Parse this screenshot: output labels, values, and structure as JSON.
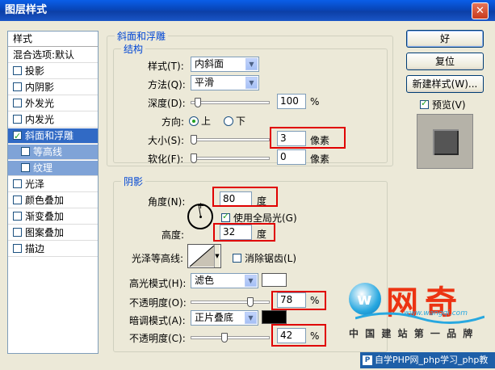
{
  "window": {
    "title": "图层样式",
    "close_glyph": "✕"
  },
  "left_list": {
    "header": "样式",
    "blend_default": "混合选项:默认",
    "items": [
      {
        "label": "投影",
        "checked": false
      },
      {
        "label": "内阴影",
        "checked": false
      },
      {
        "label": "外发光",
        "checked": false
      },
      {
        "label": "内发光",
        "checked": false
      },
      {
        "label": "斜面和浮雕",
        "checked": true,
        "selected": true
      },
      {
        "label": "等高线",
        "checked": false,
        "sub": true
      },
      {
        "label": "纹理",
        "checked": false,
        "sub": true
      },
      {
        "label": "光泽",
        "checked": false
      },
      {
        "label": "颜色叠加",
        "checked": false
      },
      {
        "label": "渐变叠加",
        "checked": false
      },
      {
        "label": "图案叠加",
        "checked": false
      },
      {
        "label": "描边",
        "checked": false
      }
    ]
  },
  "bevel": {
    "section_title": "斜面和浮雕",
    "structure_title": "结构",
    "style_label": "样式(T):",
    "style_value": "内斜面",
    "technique_label": "方法(Q):",
    "technique_value": "平滑",
    "depth_label": "深度(D):",
    "depth_value": "100",
    "depth_unit": "%",
    "direction_label": "方向:",
    "dir_up": "上",
    "dir_down": "下",
    "size_label": "大小(S):",
    "size_value": "3",
    "size_unit": "像素",
    "soften_label": "软化(F):",
    "soften_value": "0",
    "soften_unit": "像素"
  },
  "shading": {
    "title": "阴影",
    "angle_label": "角度(N):",
    "angle_value": "80",
    "angle_unit": "度",
    "global_light_label": "使用全局光(G)",
    "altitude_label": "高度:",
    "altitude_value": "32",
    "altitude_unit": "度",
    "gloss_label": "光泽等高线:",
    "antialias_label": "消除锯齿(L)",
    "highlight_mode_label": "高光模式(H):",
    "highlight_mode_value": "滤色",
    "highlight_opacity_label": "不透明度(O):",
    "highlight_opacity_value": "78",
    "highlight_opacity_unit": "%",
    "shadow_mode_label": "暗调模式(A):",
    "shadow_mode_value": "正片叠底",
    "shadow_opacity_label": "不透明度(C):",
    "shadow_opacity_value": "42",
    "shadow_opacity_unit": "%"
  },
  "buttons": {
    "ok": "好",
    "reset": "复位",
    "new_style": "新建样式(W)...",
    "preview": "预览(V)"
  },
  "watermark": {
    "logo_text": "网奇",
    "url": "www.wangqi.com",
    "slogan": "中 国 建 站 第 一 品 牌",
    "footer": "自学PHP网_php学习_php教"
  },
  "colors": {
    "accent": "#0046d5",
    "highlight": "#ec3312",
    "sel": "#316ac5"
  },
  "sliders": {
    "depth": 0.06,
    "size": 0.0,
    "soften": 0.0,
    "highlight_opacity": 0.78,
    "shadow_opacity": 0.42
  }
}
